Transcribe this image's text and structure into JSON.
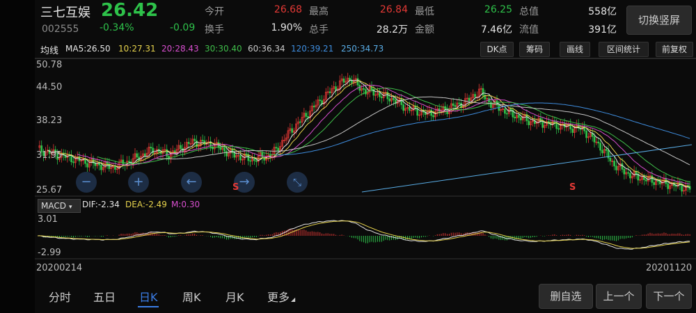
{
  "stock": {
    "name": "三七互娱",
    "code": "002555",
    "price": "26.42",
    "change_pct": "-0.34%",
    "change": "-0.09",
    "switch_button": "切换竖屏"
  },
  "quote": {
    "open_label": "今开",
    "open": "26.68",
    "high_label": "最高",
    "high": "26.84",
    "low_label": "最低",
    "low": "26.25",
    "mcap_label": "总值",
    "mcap": "558亿",
    "turnover_label": "换手",
    "turnover": "1.90%",
    "volume_label": "总手",
    "volume": "28.2万",
    "amount_label": "金额",
    "amount": "7.46亿",
    "float_label": "流值",
    "float": "391亿"
  },
  "ma_bar": {
    "label": "均线",
    "ma5": "MA5:26.50",
    "ma10": "10:27.31",
    "ma20": "20:28.43",
    "ma30": "30:30.40",
    "ma60": "60:36.34",
    "ma120": "120:39.21",
    "ma250": "250:34.73",
    "buttons": [
      "DK点",
      "筹码",
      "画线",
      "区间统计",
      "前复权"
    ]
  },
  "price_axis": [
    "50.78",
    "44.50",
    "38.23",
    "31.95",
    "25.67"
  ],
  "signals": [
    "S",
    "S"
  ],
  "macd": {
    "selector": "MACD",
    "dif": "DIF:-2.34",
    "dea": "DEA:-2.49",
    "m": "M:0.30",
    "axis_top": "3.01",
    "axis_bottom": "-2.99"
  },
  "dates": {
    "start": "20200214",
    "end": "20201120"
  },
  "tabs": [
    "分时",
    "五日",
    "日K",
    "周K",
    "月K",
    "更多"
  ],
  "actions": {
    "remove": "删自选",
    "prev": "上一个",
    "next": "下一个"
  },
  "colors": {
    "up": "#e53935",
    "down": "#2ec24a",
    "accent": "#3b7ee8"
  },
  "zoom_controls": [
    "zoom-out-icon",
    "zoom-in-icon",
    "scroll-left-icon",
    "scroll-right-icon",
    "collapse-icon"
  ]
}
